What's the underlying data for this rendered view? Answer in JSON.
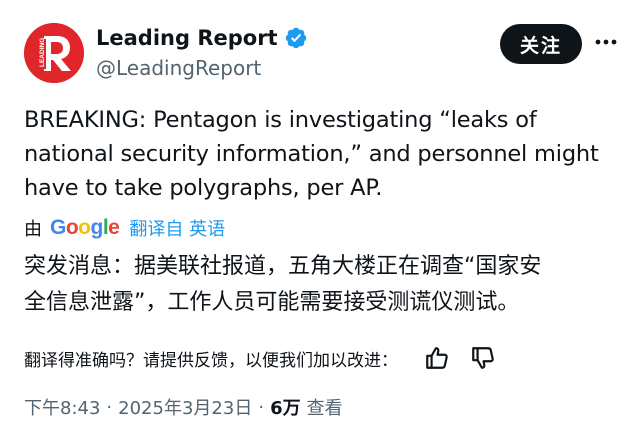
{
  "account": {
    "display_name": "Leading Report",
    "handle": "@LeadingReport",
    "verified": true,
    "avatar_letter": "R",
    "avatar_text": "LEADING",
    "avatar_color": "#e0262b"
  },
  "actions": {
    "follow_label": "关注",
    "more_icon": "more-horizontal-icon"
  },
  "tweet": {
    "lines": [
      "BREAKING: Pentagon is investigating “leaks of",
      "national security information,” and personnel might",
      "have to take polygraphs, per AP."
    ]
  },
  "translation": {
    "by_prefix": "由",
    "provider": "Google",
    "link_text": "翻译自 英语",
    "lines": [
      "突发消息：据美联社报道，五角大楼正在调查“国家安",
      "全信息泄露”，工作人员可能需要接受测谎仪测试。"
    ],
    "feedback_prompt": "翻译得准确吗？请提供反馈，以便我们加以改进："
  },
  "meta": {
    "time": "下午8:43",
    "date": "2025年3月23日",
    "views": "6万",
    "views_label": "查看",
    "separator": "·"
  },
  "colors": {
    "text_primary": "#0f1419",
    "text_secondary": "#536471",
    "link": "#1d9bf0",
    "verified_badge": "#1d9bf0"
  }
}
